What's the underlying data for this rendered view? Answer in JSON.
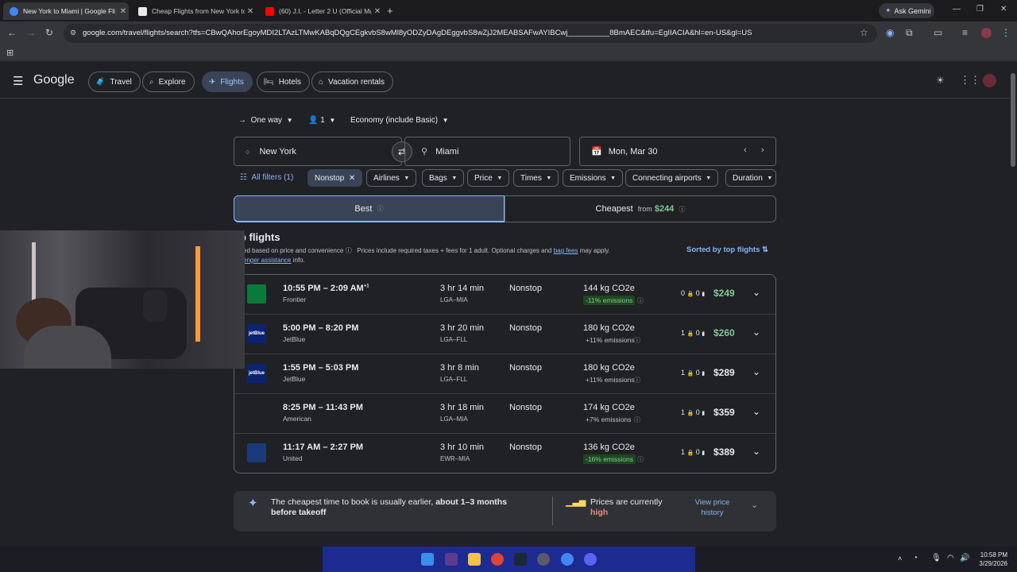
{
  "browser": {
    "tabs": [
      {
        "title": "New York to Miami | Google Fli",
        "active": true
      },
      {
        "title": "Cheap Flights from New York to",
        "active": false
      },
      {
        "title": "(60) J.I. - Letter 2 U (Official Mu",
        "active": false
      }
    ],
    "ask_gemini": "Ask Gemini",
    "url": "google.com/travel/flights/search?tfs=CBwQAhorEgoyMDI2LTAzLTMwKABqDQgCEgkvbS8wMl8yODZyDAgDEggvbS8wZjJ2MEABSAFwAYIBCwj__________8BmAEC&tfu=EgIIACIA&hl=en-US&gl=US"
  },
  "header": {
    "logo": "Google",
    "nav": [
      "Travel",
      "Explore",
      "Flights",
      "Hotels",
      "Vacation rentals"
    ],
    "selected_nav": "Flights"
  },
  "search": {
    "trip_type": "One way",
    "passengers": "1",
    "cabin": "Economy (include Basic)",
    "origin": "New York",
    "destination": "Miami",
    "date": "Mon, Mar 30"
  },
  "filters": {
    "all_filters": "All filters (1)",
    "active": "Nonstop",
    "items": [
      "Airlines",
      "Bags",
      "Price",
      "Times",
      "Emissions",
      "Connecting airports",
      "Duration"
    ]
  },
  "sort_tabs": {
    "best": "Best",
    "cheapest": "Cheapest",
    "cheapest_from": "from",
    "cheapest_price": "$244"
  },
  "results": {
    "heading": "p flights",
    "subtitle_1": "ked based on price and convenience",
    "subtitle_2": "Prices include required taxes + fees for 1 adult. Optional charges and",
    "bag_fees": "bag fees",
    "subtitle_3": "may apply.",
    "subtitle_4": "senger assistance",
    "subtitle_5": "info.",
    "sorted_by": "Sorted by top flights",
    "flights": [
      {
        "times": "10:55 PM – 2:09 AM",
        "plus": "+1",
        "airline": "Frontier",
        "duration": "3 hr 14 min",
        "route": "LGA–MIA",
        "stops": "Nonstop",
        "co2": "144 kg CO2e",
        "emissions": "-11% emissions",
        "good": true,
        "bags_carry": "0",
        "bags_checked": "0",
        "price": "$249",
        "price_green": true,
        "logo_color": "#0a7a3a",
        "logo_text": ""
      },
      {
        "times": "5:00 PM – 8:20 PM",
        "plus": "",
        "airline": "JetBlue",
        "duration": "3 hr 20 min",
        "route": "LGA–FLL",
        "stops": "Nonstop",
        "co2": "180 kg CO2e",
        "emissions": "+11% emissions",
        "good": false,
        "bags_carry": "1",
        "bags_checked": "0",
        "price": "$260",
        "price_green": true,
        "logo_color": "#0c2372",
        "logo_text": "jetBlue"
      },
      {
        "times": "1:55 PM – 5:03 PM",
        "plus": "",
        "airline": "JetBlue",
        "duration": "3 hr 8 min",
        "route": "LGA–FLL",
        "stops": "Nonstop",
        "co2": "180 kg CO2e",
        "emissions": "+11% emissions",
        "good": false,
        "bags_carry": "1",
        "bags_checked": "0",
        "price": "$289",
        "price_green": false,
        "logo_color": "#0c2372",
        "logo_text": "jetBlue"
      },
      {
        "times": "8:25 PM – 11:43 PM",
        "plus": "",
        "airline": "American",
        "duration": "3 hr 18 min",
        "route": "LGA–MIA",
        "stops": "Nonstop",
        "co2": "174 kg CO2e",
        "emissions": "+7% emissions",
        "good": false,
        "bags_carry": "1",
        "bags_checked": "0",
        "price": "$359",
        "price_green": false,
        "logo_color": "#202124",
        "logo_text": ""
      },
      {
        "times": "11:17 AM – 2:27 PM",
        "plus": "",
        "airline": "United",
        "duration": "3 hr 10 min",
        "route": "EWR–MIA",
        "stops": "Nonstop",
        "co2": "136 kg CO2e",
        "emissions": "-16% emissions",
        "good": true,
        "bags_carry": "1",
        "bags_checked": "0",
        "price": "$389",
        "price_green": false,
        "logo_color": "#1a3a7a",
        "logo_text": ""
      }
    ]
  },
  "insight": {
    "text_a": "The cheapest time to book is usually earlier,",
    "text_b": "about 1–3 months",
    "text_c": "before takeoff",
    "prices_label": "Prices are currently",
    "prices_status": "high",
    "history_link": "View price history"
  },
  "taskbar": {
    "time": "10:58 PM",
    "date": "3/29/2026"
  },
  "colors": {
    "accent": "#8ab4f8",
    "green": "#81c995",
    "high": "#f28b82"
  }
}
